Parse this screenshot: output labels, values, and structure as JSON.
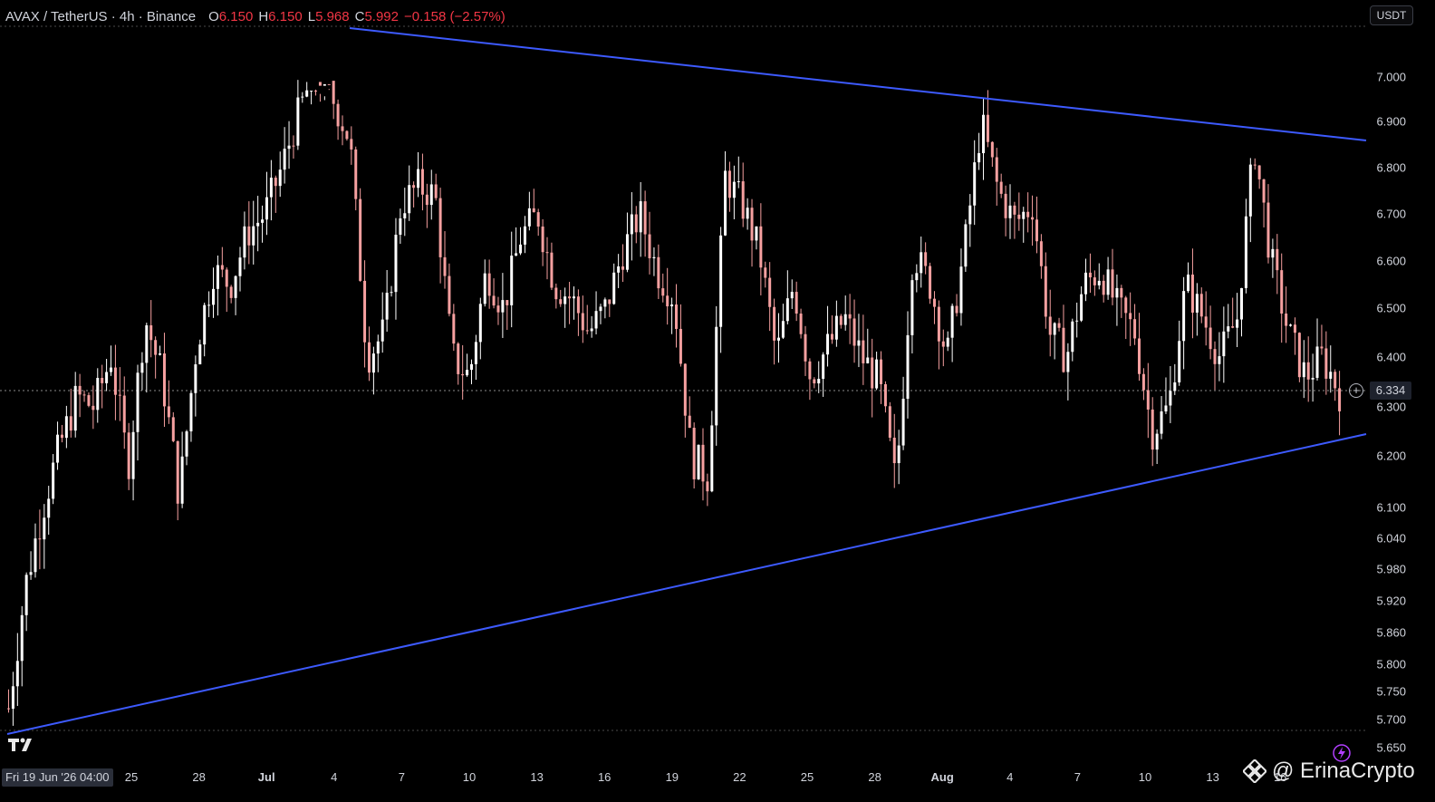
{
  "header": {
    "symbol": "AVAX / TetherUS · 4h · Binance",
    "open_label": "O",
    "open": "6.150",
    "high_label": "H",
    "high": "6.150",
    "low_label": "L",
    "low": "5.968",
    "close_label": "C",
    "close": "5.992",
    "change": "−0.158 (−2.57%)"
  },
  "currency_button": "USDT",
  "current_price": "6.334",
  "cursor_date": "Fri 19 Jun '26  04:00",
  "watermark": "@ ErinaCrypto",
  "colors": {
    "background": "#000000",
    "candle_up": "#ffffff",
    "candle_down": "#f6a0a0",
    "trendline": "#3d5afe",
    "text": "#d1d4dc",
    "negative": "#f23645"
  },
  "icons": {
    "logo": "tradingview-logo-icon",
    "alert": "add-alert-icon",
    "watermark": "binance-logo-icon",
    "lightning": "lightning-icon"
  },
  "chart_data": {
    "type": "candlestick",
    "price_axis_ticks": [
      "7.000",
      "6.900",
      "6.800",
      "6.700",
      "6.600",
      "6.500",
      "6.400",
      "6.300",
      "6.200",
      "6.100",
      "6.040",
      "5.980",
      "5.920",
      "5.860",
      "5.800",
      "5.750",
      "5.700",
      "5.650"
    ],
    "time_axis_ticks": [
      {
        "label": "25",
        "month": false
      },
      {
        "label": "28",
        "month": false
      },
      {
        "label": "Jul",
        "month": true
      },
      {
        "label": "4",
        "month": false
      },
      {
        "label": "7",
        "month": false
      },
      {
        "label": "10",
        "month": false
      },
      {
        "label": "13",
        "month": false
      },
      {
        "label": "16",
        "month": false
      },
      {
        "label": "19",
        "month": false
      },
      {
        "label": "22",
        "month": false
      },
      {
        "label": "25",
        "month": false
      },
      {
        "label": "28",
        "month": false
      },
      {
        "label": "Aug",
        "month": true
      },
      {
        "label": "4",
        "month": false
      },
      {
        "label": "7",
        "month": false
      },
      {
        "label": "10",
        "month": false
      },
      {
        "label": "13",
        "month": false
      },
      {
        "label": "16",
        "month": false
      }
    ],
    "approx_price_path": [
      5.72,
      5.95,
      6.1,
      6.22,
      6.32,
      6.3,
      6.4,
      6.18,
      6.48,
      6.36,
      6.12,
      6.42,
      6.58,
      6.55,
      6.66,
      6.7,
      6.8,
      6.92,
      7.02,
      6.95,
      6.86,
      6.4,
      6.45,
      6.72,
      6.76,
      6.74,
      6.4,
      6.36,
      6.58,
      6.5,
      6.65,
      6.7,
      6.55,
      6.52,
      6.45,
      6.5,
      6.62,
      6.7,
      6.58,
      6.52,
      6.2,
      6.16,
      6.78,
      6.72,
      6.62,
      6.4,
      6.55,
      6.36,
      6.42,
      6.48,
      6.4,
      6.35,
      6.14,
      6.62,
      6.55,
      6.4,
      6.62,
      6.9,
      6.75,
      6.68,
      6.72,
      6.45,
      6.4,
      6.55,
      6.58,
      6.5,
      6.45,
      6.25,
      6.3,
      6.55,
      6.48,
      6.4,
      6.48,
      6.85,
      6.6,
      6.45,
      6.36,
      6.4,
      6.33
    ]
  }
}
